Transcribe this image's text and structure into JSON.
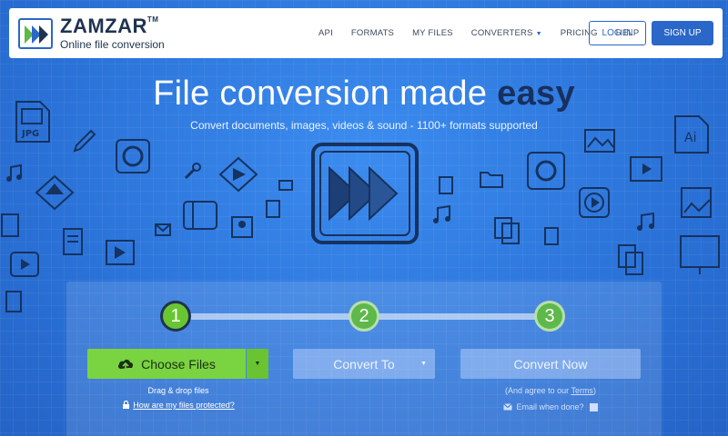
{
  "header": {
    "logo_name": "ZAMZAR",
    "logo_tm": "TM",
    "logo_tagline": "Online file conversion",
    "nav": [
      {
        "label": "API"
      },
      {
        "label": "FORMATS"
      },
      {
        "label": "MY FILES"
      },
      {
        "label": "CONVERTERS",
        "has_dropdown": true
      },
      {
        "label": "PRICING"
      },
      {
        "label": "HELP"
      }
    ],
    "login_label": "LOG IN",
    "signup_label": "SIGN UP"
  },
  "hero": {
    "title_main": "File conversion made ",
    "title_emph": "easy",
    "subtitle": "Convert documents, images, videos & sound - 1100+ formats supported",
    "doodle_labels": {
      "jpg": "JPG",
      "ai": "Ai"
    }
  },
  "converter": {
    "steps": [
      "1",
      "2",
      "3"
    ],
    "active_step": 1,
    "choose_files_label": "Choose Files",
    "drag_drop_text": "Drag & drop files",
    "protected_link": "How are my files protected?",
    "convert_to_label": "Convert To",
    "convert_now_label": "Convert Now",
    "agree_prefix": "(And agree to our ",
    "terms_link": "Terms",
    "agree_suffix": ")",
    "email_label": "Email when done?"
  },
  "colors": {
    "background": "#2f7be0",
    "brand_blue": "#2a67c9",
    "green": "#7ad340",
    "dark_navy": "#17305f"
  }
}
